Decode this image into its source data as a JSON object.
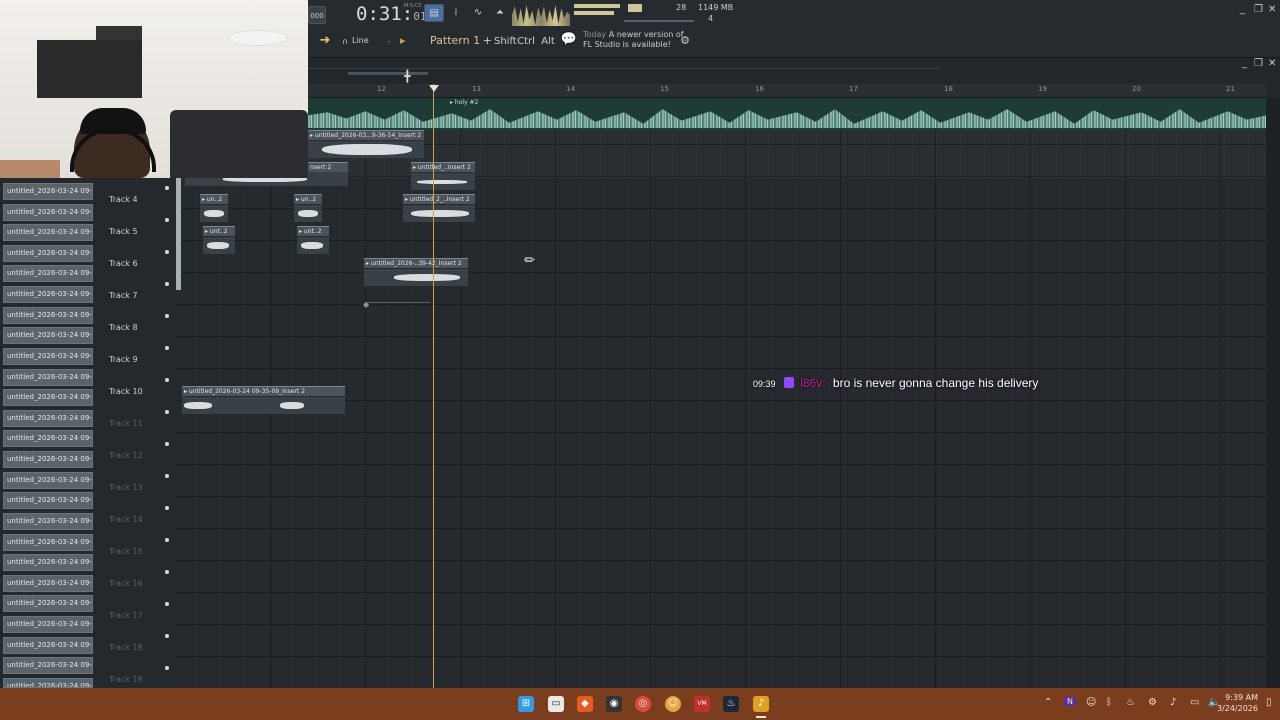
{
  "toolbar": {
    "time_main": "0:31",
    "time_sub": "01",
    "time_small_label": "M:S:CS",
    "left_edge": "000",
    "cpu": "28",
    "mem": "1149 MB",
    "mem_sub": "4",
    "mode": "Line",
    "pattern": "Pattern 1",
    "shift": "Shift",
    "ctrl": "Ctrl",
    "alt": "Alt",
    "news_when": "Today",
    "news_text": "A newer version of",
    "news_text2": "FL Studio is available!"
  },
  "ruler": {
    "bars": [
      "12",
      "13",
      "14",
      "15",
      "16",
      "17",
      "18",
      "19",
      "20",
      "21"
    ]
  },
  "master_clip": {
    "label": "holy #2"
  },
  "clips": {
    "c1": "untitled_2026-03...9-36-54_Insert 2",
    "c2": "nsert 2",
    "c3": "untitled_..Insert 2",
    "c4": "un..2",
    "c5": "un..2",
    "c6": "untitled_2_..Insert 2",
    "c7": "unt..2",
    "c8": "unt..2",
    "c9": "untitled_2026-..39-42_Insert 2",
    "c10": "untitled_2026-03-24 09-35-09_Insert 2"
  },
  "picker": "untitled_2026-03-24 09-",
  "tracks": [
    "Track 4",
    "Track 5",
    "Track 6",
    "Track 7",
    "Track 8",
    "Track 9",
    "Track 10",
    "Track 11",
    "Track 12",
    "Track 13",
    "Track 14",
    "Track 15",
    "Track 16",
    "Track 17",
    "Track 18",
    "Track 19"
  ],
  "chat": {
    "time": "09:39",
    "user": "l86v:",
    "message": "bro is never gonna change his delivery"
  },
  "clock": {
    "time": "9:39 AM",
    "date": "3/24/2026"
  },
  "colors": {
    "accent": "#c8a34a",
    "taskbar": "#7a3e1e",
    "master_wave": "#7fb0a3"
  }
}
